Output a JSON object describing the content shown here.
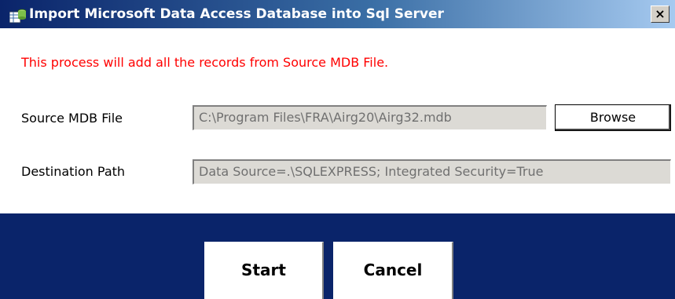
{
  "window": {
    "title": "Import Microsoft Data Access Database into Sql Server",
    "close_label": "×",
    "icon": "database-app-icon"
  },
  "message": "This process will add all the records from Source MDB File.",
  "source": {
    "label": "Source MDB File",
    "value": "C:\\Program Files\\FRA\\Airg20\\Airg32.mdb",
    "browse_label": "Browse"
  },
  "destination": {
    "label": "Destination Path",
    "value": "Data Source=.\\SQLEXPRESS; Integrated Security=True"
  },
  "buttons": {
    "start": "Start",
    "cancel": "Cancel"
  },
  "colors": {
    "title_start": "#0a246a",
    "title_end": "#a6caf0",
    "message": "#ff0000",
    "footer": "#0a246a"
  }
}
